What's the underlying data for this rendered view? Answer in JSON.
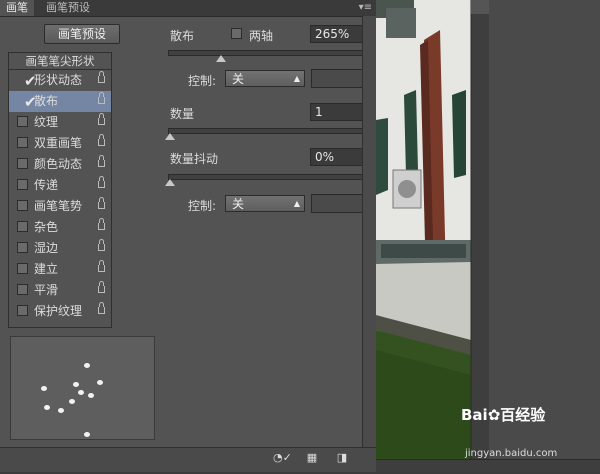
{
  "tabs": [
    {
      "label": "画笔"
    },
    {
      "label": "画笔预设"
    }
  ],
  "tab_menu_icon": "▾≡",
  "preset_button": "画笔预设",
  "tree": {
    "header": "画笔笔尖形状",
    "items": [
      {
        "label": "形状动态",
        "checked": true,
        "selected": false
      },
      {
        "label": "散布",
        "checked": true,
        "selected": true
      },
      {
        "label": "纹理",
        "checked": false,
        "selected": false
      },
      {
        "label": "双重画笔",
        "checked": false,
        "selected": false
      },
      {
        "label": "颜色动态",
        "checked": false,
        "selected": false
      },
      {
        "label": "传递",
        "checked": false,
        "selected": false
      },
      {
        "label": "画笔笔势",
        "checked": false,
        "selected": false
      },
      {
        "label": "杂色",
        "checked": false,
        "selected": false
      },
      {
        "label": "湿边",
        "checked": false,
        "selected": false
      },
      {
        "label": "建立",
        "checked": false,
        "selected": false
      },
      {
        "label": "平滑",
        "checked": false,
        "selected": false
      },
      {
        "label": "保护纹理",
        "checked": false,
        "selected": false
      }
    ]
  },
  "scatter": {
    "label": "散布",
    "both_axes_label": "两轴",
    "value": "265%",
    "control_label": "控制:",
    "control_value": "关"
  },
  "count": {
    "label": "数量",
    "value": "1"
  },
  "count_jitter": {
    "label": "数量抖动",
    "value": "0%",
    "control_label": "控制:",
    "control_value": "关"
  },
  "watermark": {
    "brand": "Bai✿百经验",
    "url": "jingyan.baidu.com"
  }
}
